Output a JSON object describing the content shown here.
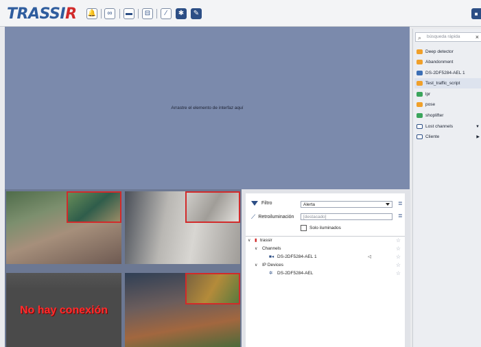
{
  "app": {
    "logo_main": "TRASSI",
    "logo_accent": "R"
  },
  "toolbar": {
    "buttons": [
      {
        "icon": "bell-icon",
        "glyph": "🔔"
      },
      {
        "icon": "voicemail-icon",
        "glyph": "∞"
      },
      {
        "icon": "chat-icon",
        "glyph": "▬"
      },
      {
        "icon": "layout-icon",
        "glyph": "⊟"
      },
      {
        "icon": "magic-wand-icon",
        "glyph": "⁄"
      },
      {
        "icon": "puzzle-icon",
        "glyph": "✱"
      },
      {
        "icon": "edit-icon",
        "glyph": "✎"
      }
    ],
    "camera_button_glyph": "■"
  },
  "dropzone": {
    "text": "Arrastre el elemento de interfaz aquí"
  },
  "cameras": {
    "no_connection": "No hay conexión"
  },
  "filter": {
    "filter_label": "Filtro",
    "filter_value": "Alerta",
    "backlight_label": "Retroiluminación",
    "backlight_placeholder": "[destacado]",
    "only_lit_label": "Solo iluminados"
  },
  "tree": {
    "root": "trassir",
    "channels": "Channels",
    "channel_item": "DS-2DF5284-AEL 1",
    "ip_devices": "IP Devices",
    "ip_item": "DS-2DF5284-AEL",
    "star": "☆"
  },
  "right_panel": {
    "search_placeholder": "búsqueda rápida",
    "items": [
      {
        "label": "Deep detector",
        "icon": "orange"
      },
      {
        "label": "Abandonment",
        "icon": "orange"
      },
      {
        "label": "DS-2DF5284-AEL 1",
        "icon": "blue"
      },
      {
        "label": "Test_traffic_script",
        "icon": "orange"
      },
      {
        "label": "lpr",
        "icon": "green"
      },
      {
        "label": "pose",
        "icon": "orange"
      },
      {
        "label": "shoplifter",
        "icon": "green"
      },
      {
        "label": "Lost channels",
        "icon": "folder"
      },
      {
        "label": "Cliente",
        "icon": "folder"
      }
    ]
  }
}
